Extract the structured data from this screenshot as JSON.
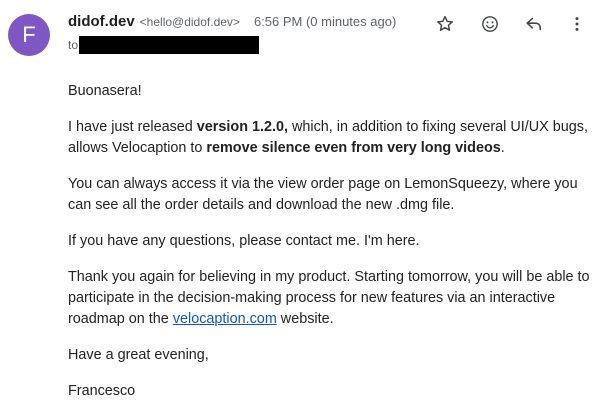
{
  "header": {
    "avatar_letter": "F",
    "avatar_color": "#7e57c2",
    "sender_name": "didof.dev",
    "sender_email": "<hello@didof.dev>",
    "timestamp": "6:56 PM (0 minutes ago)",
    "to_label": "to",
    "actions": {
      "star": "star-icon",
      "emoji": "emoji-reaction-icon",
      "reply": "reply-icon",
      "more": "more-vert-icon"
    }
  },
  "body": {
    "greeting": "Buonasera!",
    "p1_prefix": "I have just released ",
    "p1_version": "version 1.2.0,",
    "p1_middle": " which, in addition to fixing several UI/UX bugs, allows Velocaption to ",
    "p1_feature": "remove silence even from very long videos",
    "p1_suffix": ".",
    "p2": "You can always access it via the view order page on LemonSqueezy, where you can see all the order details and download the new .dmg file.",
    "p3": "If you have any questions, please contact me. I'm here.",
    "p4_prefix": "Thank you again for believing in my product. Starting tomorrow, you will be able to participate in the decision-making process for new features via an interactive roadmap on the ",
    "p4_link": "velocaption.com",
    "p4_suffix": " website.",
    "closing": "Have a great evening,",
    "signature": "Francesco"
  },
  "colors": {
    "link": "#1155cc",
    "meta_text": "#5f6368"
  }
}
